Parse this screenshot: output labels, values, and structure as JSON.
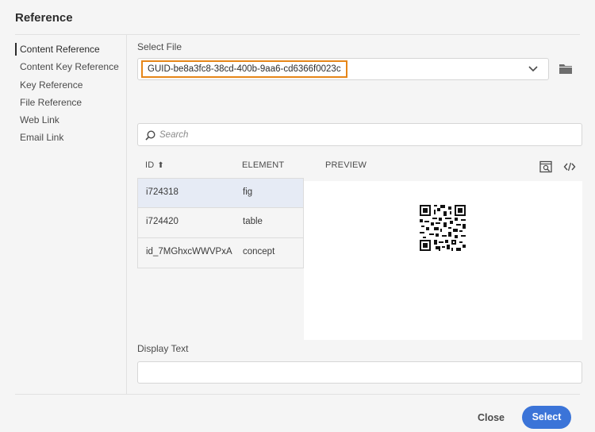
{
  "dialog": {
    "title": "Reference"
  },
  "sidebar": {
    "items": [
      {
        "label": "Content Reference",
        "active": true
      },
      {
        "label": "Content Key Reference"
      },
      {
        "label": "Key Reference"
      },
      {
        "label": "File Reference"
      },
      {
        "label": "Web Link"
      },
      {
        "label": "Email Link"
      }
    ]
  },
  "select_file": {
    "label": "Select File",
    "value": "GUID-be8a3fc8-38cd-400b-9aa6-cd6366f0023c",
    "dropdown_icon": "chevron-down-icon",
    "browse_icon": "folder-icon"
  },
  "search": {
    "placeholder": "Search",
    "icon": "search-icon"
  },
  "table": {
    "headers": {
      "id": "ID",
      "element": "ELEMENT",
      "preview": "PREVIEW"
    },
    "sort": "ascending",
    "rows": [
      {
        "id": "i724318",
        "element": "fig",
        "selected": true
      },
      {
        "id": "i724420",
        "element": "table"
      },
      {
        "id": "id_7MGhxcWWVPxA",
        "element": "concept"
      }
    ]
  },
  "preview": {
    "toolbar_icons": [
      "preview-search-icon",
      "code-icon"
    ],
    "image": "qr-code"
  },
  "display_text": {
    "label": "Display Text",
    "value": ""
  },
  "footer": {
    "close_label": "Close",
    "select_label": "Select"
  },
  "colors": {
    "accent": "#3b74d8",
    "focus_outline": "#e68619",
    "selected_row": "#e6ebf5"
  }
}
